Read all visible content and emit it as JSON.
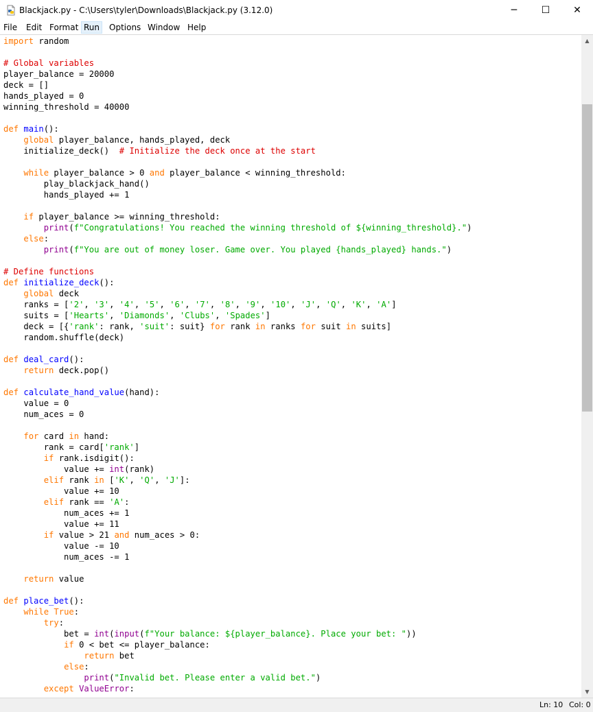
{
  "window": {
    "title": "Blackjack.py - C:\\Users\\tyler\\Downloads\\Blackjack.py (3.12.0)",
    "minimize_glyph": "─",
    "maximize_glyph": "☐",
    "close_glyph": "✕",
    "icon": "python-file-icon"
  },
  "menu": {
    "items": [
      "File",
      "Edit",
      "Format",
      "Run",
      "Options",
      "Window",
      "Help"
    ],
    "active": "Run"
  },
  "editor": {
    "lines": [
      [
        {
          "t": "import",
          "c": "kw"
        },
        {
          "t": " random"
        }
      ],
      [],
      [
        {
          "t": "# Global variables",
          "c": "cm"
        }
      ],
      [
        {
          "t": "player_balance = 20000"
        }
      ],
      [
        {
          "t": "deck = []"
        }
      ],
      [
        {
          "t": "hands_played = 0"
        }
      ],
      [
        {
          "t": "winning_threshold = 40000"
        }
      ],
      [],
      [
        {
          "t": "def",
          "c": "kw"
        },
        {
          "t": " "
        },
        {
          "t": "main",
          "c": "fn"
        },
        {
          "t": "():"
        }
      ],
      [
        {
          "t": "    "
        },
        {
          "t": "global",
          "c": "kw"
        },
        {
          "t": " player_balance, hands_played, deck"
        }
      ],
      [
        {
          "t": "    initialize_deck()  "
        },
        {
          "t": "# Initialize the deck once at the start",
          "c": "cm"
        }
      ],
      [],
      [
        {
          "t": "    "
        },
        {
          "t": "while",
          "c": "kw"
        },
        {
          "t": " player_balance > 0 "
        },
        {
          "t": "and",
          "c": "kw"
        },
        {
          "t": " player_balance < winning_threshold:"
        }
      ],
      [
        {
          "t": "        play_blackjack_hand()"
        }
      ],
      [
        {
          "t": "        hands_played += 1"
        }
      ],
      [],
      [
        {
          "t": "    "
        },
        {
          "t": "if",
          "c": "kw"
        },
        {
          "t": " player_balance >= winning_threshold:"
        }
      ],
      [
        {
          "t": "        "
        },
        {
          "t": "print",
          "c": "bi"
        },
        {
          "t": "("
        },
        {
          "t": "f\"Congratulations! You reached the winning threshold of ${winning_threshold}.\"",
          "c": "str"
        },
        {
          "t": ")"
        }
      ],
      [
        {
          "t": "    "
        },
        {
          "t": "else",
          "c": "kw"
        },
        {
          "t": ":"
        }
      ],
      [
        {
          "t": "        "
        },
        {
          "t": "print",
          "c": "bi"
        },
        {
          "t": "("
        },
        {
          "t": "f\"You are out of money loser. Game over. You played {hands_played} hands.\"",
          "c": "str"
        },
        {
          "t": ")"
        }
      ],
      [],
      [
        {
          "t": "# Define functions",
          "c": "cm"
        }
      ],
      [
        {
          "t": "def",
          "c": "kw"
        },
        {
          "t": " "
        },
        {
          "t": "initialize_deck",
          "c": "fn"
        },
        {
          "t": "():"
        }
      ],
      [
        {
          "t": "    "
        },
        {
          "t": "global",
          "c": "kw"
        },
        {
          "t": " deck"
        }
      ],
      [
        {
          "t": "    ranks = ["
        },
        {
          "t": "'2'",
          "c": "str"
        },
        {
          "t": ", "
        },
        {
          "t": "'3'",
          "c": "str"
        },
        {
          "t": ", "
        },
        {
          "t": "'4'",
          "c": "str"
        },
        {
          "t": ", "
        },
        {
          "t": "'5'",
          "c": "str"
        },
        {
          "t": ", "
        },
        {
          "t": "'6'",
          "c": "str"
        },
        {
          "t": ", "
        },
        {
          "t": "'7'",
          "c": "str"
        },
        {
          "t": ", "
        },
        {
          "t": "'8'",
          "c": "str"
        },
        {
          "t": ", "
        },
        {
          "t": "'9'",
          "c": "str"
        },
        {
          "t": ", "
        },
        {
          "t": "'10'",
          "c": "str"
        },
        {
          "t": ", "
        },
        {
          "t": "'J'",
          "c": "str"
        },
        {
          "t": ", "
        },
        {
          "t": "'Q'",
          "c": "str"
        },
        {
          "t": ", "
        },
        {
          "t": "'K'",
          "c": "str"
        },
        {
          "t": ", "
        },
        {
          "t": "'A'",
          "c": "str"
        },
        {
          "t": "]"
        }
      ],
      [
        {
          "t": "    suits = ["
        },
        {
          "t": "'Hearts'",
          "c": "str"
        },
        {
          "t": ", "
        },
        {
          "t": "'Diamonds'",
          "c": "str"
        },
        {
          "t": ", "
        },
        {
          "t": "'Clubs'",
          "c": "str"
        },
        {
          "t": ", "
        },
        {
          "t": "'Spades'",
          "c": "str"
        },
        {
          "t": "]"
        }
      ],
      [
        {
          "t": "    deck = [{"
        },
        {
          "t": "'rank'",
          "c": "str"
        },
        {
          "t": ": rank, "
        },
        {
          "t": "'suit'",
          "c": "str"
        },
        {
          "t": ": suit} "
        },
        {
          "t": "for",
          "c": "kw"
        },
        {
          "t": " rank "
        },
        {
          "t": "in",
          "c": "kw"
        },
        {
          "t": " ranks "
        },
        {
          "t": "for",
          "c": "kw"
        },
        {
          "t": " suit "
        },
        {
          "t": "in",
          "c": "kw"
        },
        {
          "t": " suits]"
        }
      ],
      [
        {
          "t": "    random.shuffle(deck)"
        }
      ],
      [],
      [
        {
          "t": "def",
          "c": "kw"
        },
        {
          "t": " "
        },
        {
          "t": "deal_card",
          "c": "fn"
        },
        {
          "t": "():"
        }
      ],
      [
        {
          "t": "    "
        },
        {
          "t": "return",
          "c": "kw"
        },
        {
          "t": " deck.pop()"
        }
      ],
      [],
      [
        {
          "t": "def",
          "c": "kw"
        },
        {
          "t": " "
        },
        {
          "t": "calculate_hand_value",
          "c": "fn"
        },
        {
          "t": "(hand):"
        }
      ],
      [
        {
          "t": "    value = 0"
        }
      ],
      [
        {
          "t": "    num_aces = 0"
        }
      ],
      [],
      [
        {
          "t": "    "
        },
        {
          "t": "for",
          "c": "kw"
        },
        {
          "t": " card "
        },
        {
          "t": "in",
          "c": "kw"
        },
        {
          "t": " hand:"
        }
      ],
      [
        {
          "t": "        rank = card["
        },
        {
          "t": "'rank'",
          "c": "str"
        },
        {
          "t": "]"
        }
      ],
      [
        {
          "t": "        "
        },
        {
          "t": "if",
          "c": "kw"
        },
        {
          "t": " rank.isdigit():"
        }
      ],
      [
        {
          "t": "            value += "
        },
        {
          "t": "int",
          "c": "bi"
        },
        {
          "t": "(rank)"
        }
      ],
      [
        {
          "t": "        "
        },
        {
          "t": "elif",
          "c": "kw"
        },
        {
          "t": " rank "
        },
        {
          "t": "in",
          "c": "kw"
        },
        {
          "t": " ["
        },
        {
          "t": "'K'",
          "c": "str"
        },
        {
          "t": ", "
        },
        {
          "t": "'Q'",
          "c": "str"
        },
        {
          "t": ", "
        },
        {
          "t": "'J'",
          "c": "str"
        },
        {
          "t": "]:"
        }
      ],
      [
        {
          "t": "            value += 10"
        }
      ],
      [
        {
          "t": "        "
        },
        {
          "t": "elif",
          "c": "kw"
        },
        {
          "t": " rank == "
        },
        {
          "t": "'A'",
          "c": "str"
        },
        {
          "t": ":"
        }
      ],
      [
        {
          "t": "            num_aces += 1"
        }
      ],
      [
        {
          "t": "            value += 11"
        }
      ],
      [
        {
          "t": "        "
        },
        {
          "t": "if",
          "c": "kw"
        },
        {
          "t": " value > 21 "
        },
        {
          "t": "and",
          "c": "kw"
        },
        {
          "t": " num_aces > 0:"
        }
      ],
      [
        {
          "t": "            value -= 10"
        }
      ],
      [
        {
          "t": "            num_aces -= 1"
        }
      ],
      [],
      [
        {
          "t": "    "
        },
        {
          "t": "return",
          "c": "kw"
        },
        {
          "t": " value"
        }
      ],
      [],
      [
        {
          "t": "def",
          "c": "kw"
        },
        {
          "t": " "
        },
        {
          "t": "place_bet",
          "c": "fn"
        },
        {
          "t": "():"
        }
      ],
      [
        {
          "t": "    "
        },
        {
          "t": "while",
          "c": "kw"
        },
        {
          "t": " "
        },
        {
          "t": "True",
          "c": "kw"
        },
        {
          "t": ":"
        }
      ],
      [
        {
          "t": "        "
        },
        {
          "t": "try",
          "c": "kw"
        },
        {
          "t": ":"
        }
      ],
      [
        {
          "t": "            bet = "
        },
        {
          "t": "int",
          "c": "bi"
        },
        {
          "t": "("
        },
        {
          "t": "input",
          "c": "bi"
        },
        {
          "t": "("
        },
        {
          "t": "f\"Your balance: ${player_balance}. Place your bet: \"",
          "c": "str"
        },
        {
          "t": "))"
        }
      ],
      [
        {
          "t": "            "
        },
        {
          "t": "if",
          "c": "kw"
        },
        {
          "t": " 0 < bet <= player_balance:"
        }
      ],
      [
        {
          "t": "                "
        },
        {
          "t": "return",
          "c": "kw"
        },
        {
          "t": " bet"
        }
      ],
      [
        {
          "t": "            "
        },
        {
          "t": "else",
          "c": "kw"
        },
        {
          "t": ":"
        }
      ],
      [
        {
          "t": "                "
        },
        {
          "t": "print",
          "c": "bi"
        },
        {
          "t": "("
        },
        {
          "t": "\"Invalid bet. Please enter a valid bet.\"",
          "c": "str"
        },
        {
          "t": ")"
        }
      ],
      [
        {
          "t": "        "
        },
        {
          "t": "except",
          "c": "kw"
        },
        {
          "t": " "
        },
        {
          "t": "ValueError",
          "c": "bi"
        },
        {
          "t": ":"
        }
      ]
    ]
  },
  "status": {
    "ln": "Ln: 10",
    "col": "Col: 0"
  },
  "scrollbar": {
    "up_glyph": "▲",
    "down_glyph": "▼",
    "thumb_position_fraction": 0.09
  },
  "colors": {
    "keyword": "#ff7700",
    "builtin": "#900090",
    "string": "#00aa00",
    "comment": "#dd0000",
    "definition": "#0000ff"
  }
}
